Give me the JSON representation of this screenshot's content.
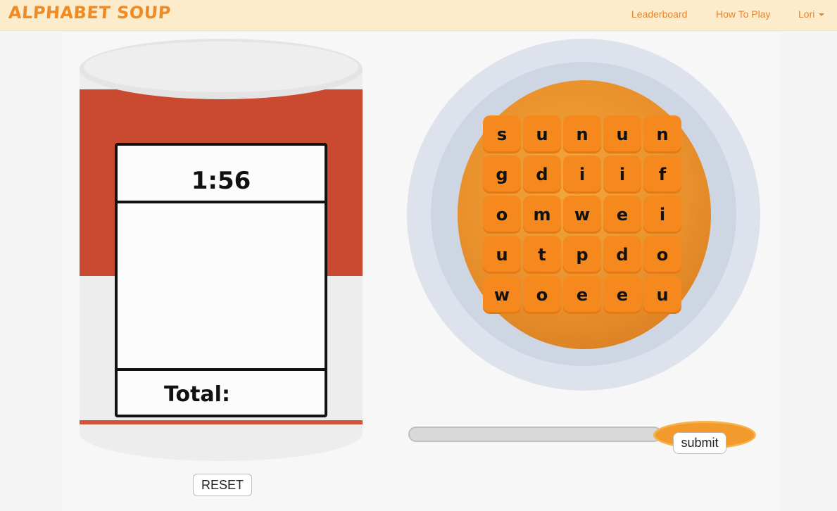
{
  "nav": {
    "brand": "ALPHABET SOUP",
    "links": [
      "Leaderboard",
      "How To Play"
    ],
    "user": "Lori"
  },
  "can": {
    "timer": "1:56",
    "total_label": "Total:",
    "reset_label": "RESET"
  },
  "board": {
    "rows": [
      [
        "s",
        "u",
        "n",
        "u",
        "n"
      ],
      [
        "g",
        "d",
        "i",
        "i",
        "f"
      ],
      [
        "o",
        "m",
        "w",
        "e",
        "i"
      ],
      [
        "u",
        "t",
        "p",
        "d",
        "o"
      ],
      [
        "w",
        "o",
        "e",
        "e",
        "u"
      ]
    ]
  },
  "spoon": {
    "submit_label": "submit"
  },
  "colors": {
    "accent": "#f08a24",
    "navbar": "#fdeccb",
    "can_red": "#c94a30",
    "tile": "#f6891d"
  }
}
